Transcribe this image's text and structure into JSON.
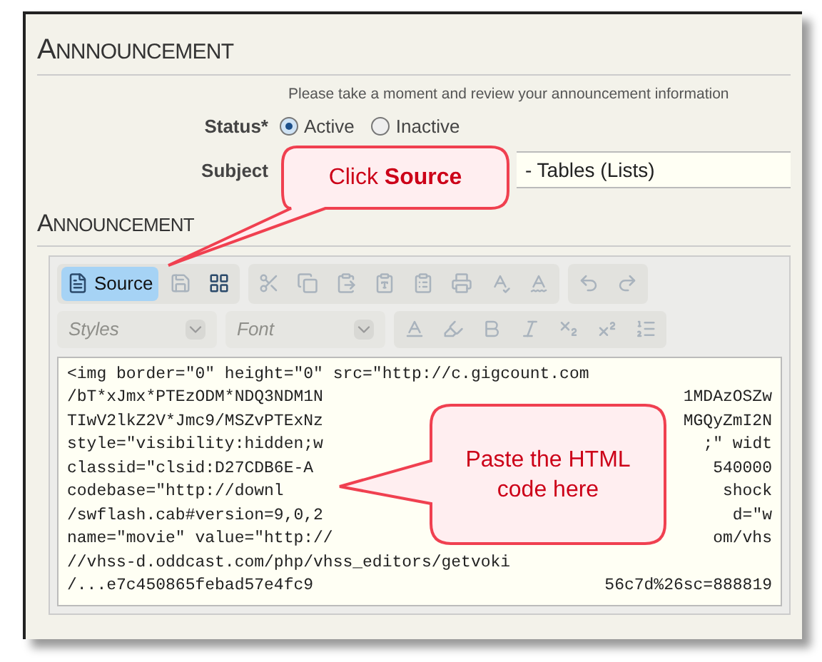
{
  "heading": "ANNNOUNCEMENT",
  "intro": "Please take a moment and review your announcement information",
  "status": {
    "label": "Status*",
    "options": [
      {
        "label": "Active",
        "selected": true
      },
      {
        "label": "Inactive",
        "selected": false
      }
    ]
  },
  "subject": {
    "label": "Subject",
    "value": "- Tables (Lists)"
  },
  "editor_heading": "ANNOUNCEMENT",
  "toolbar_row_1": [
    {
      "kind": "source",
      "label": "Source",
      "selected": true,
      "disabled": false
    },
    {
      "kind": "save",
      "selected": false,
      "disabled": true
    },
    {
      "kind": "blocks",
      "selected": false,
      "disabled": false
    },
    {
      "kind": "cut",
      "selected": false,
      "disabled": true
    },
    {
      "kind": "copy",
      "selected": false,
      "disabled": true
    },
    {
      "kind": "paste",
      "selected": false,
      "disabled": true
    },
    {
      "kind": "paste-text",
      "selected": false,
      "disabled": true
    },
    {
      "kind": "paste-word",
      "selected": false,
      "disabled": true
    },
    {
      "kind": "print",
      "selected": false,
      "disabled": true
    },
    {
      "kind": "spell",
      "selected": false,
      "disabled": true
    },
    {
      "kind": "spell-menu",
      "selected": false,
      "disabled": true
    },
    {
      "kind": "undo",
      "selected": false,
      "disabled": true
    },
    {
      "kind": "redo",
      "selected": false,
      "disabled": true
    }
  ],
  "dropdowns": [
    {
      "placeholder": "Styles"
    },
    {
      "placeholder": "Font"
    }
  ],
  "toolbar_row_2": [
    {
      "kind": "text-color",
      "disabled": true
    },
    {
      "kind": "bg-color",
      "disabled": true
    },
    {
      "kind": "bold",
      "disabled": true
    },
    {
      "kind": "italic",
      "disabled": true
    },
    {
      "kind": "subscript",
      "disabled": true
    },
    {
      "kind": "superscript",
      "disabled": true
    },
    {
      "kind": "numbered-list",
      "disabled": true
    }
  ],
  "code_lines": [
    {
      "text": "<img border=\"0\" height=\"0\" src=\"http://c.gigcount.com"
    },
    {
      "text": "/bT*xJmx*PTEzODM*NDQ3NDM1N",
      "tail": "1MDAzOSZw"
    },
    {
      "text": "TIwV2lkZ2V*Jmc9/MSZvPTExNz",
      "tail": "MGQyZmI2N"
    },
    {
      "text": "style=\"visibility:hidden;w",
      "tail": ";\" widt"
    },
    {
      "text": "classid=\"clsid:D27CDB6E-A",
      "tail": "540000"
    },
    {
      "text": "codebase=\"http://downl",
      "tail": "shock"
    },
    {
      "text": "/swflash.cab#version=9,0,2",
      "tail": "d=\"w"
    },
    {
      "text": "name=\"movie\" value=\"http://",
      "tail": "om/vhs"
    },
    {
      "text": "//vhss-d.oddcast.com/php/vhss_editors/getvoki"
    },
    {
      "text": "/...e7c450865febad57e4fc9",
      "tail": "56c7d%26sc=888819"
    }
  ],
  "callouts": [
    {
      "text": "Click **Source**"
    },
    {
      "text": "Paste the HTML code here"
    }
  ]
}
